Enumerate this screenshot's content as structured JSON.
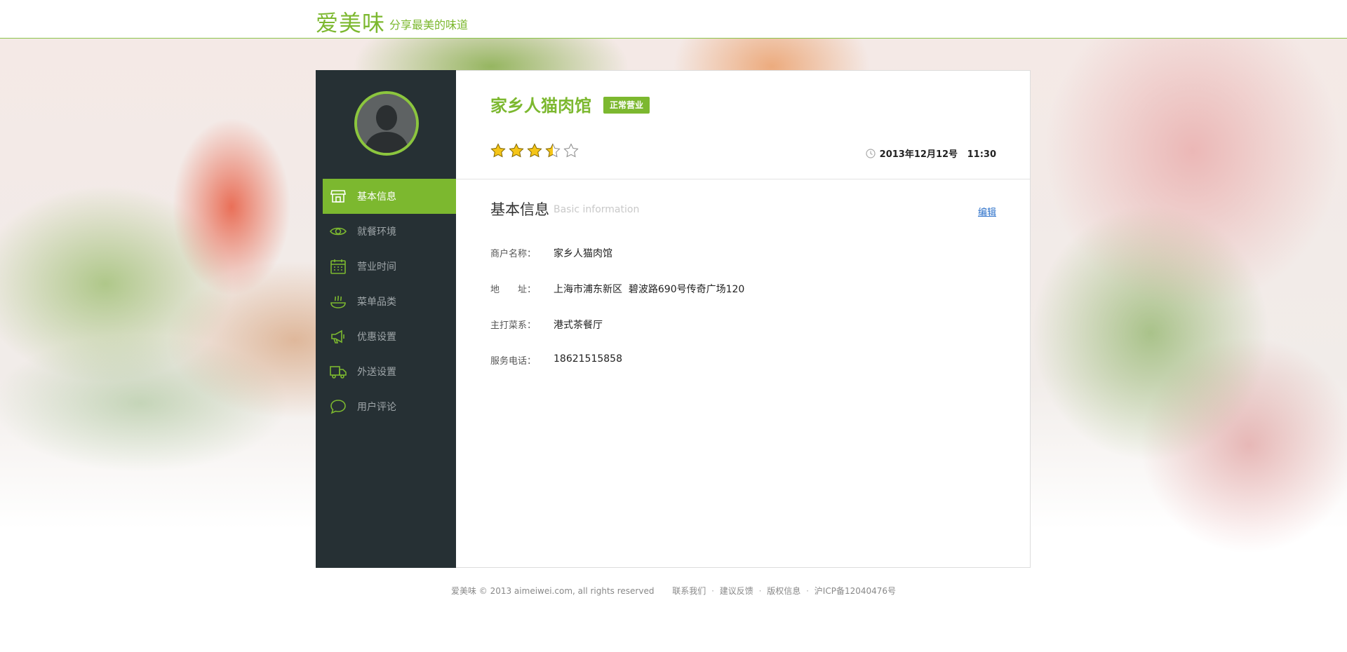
{
  "header": {
    "logo": "爱美味",
    "slogan": "分享最美的味道"
  },
  "sidebar": {
    "items": [
      {
        "label": "基本信息",
        "icon": "store-icon",
        "active": true
      },
      {
        "label": "就餐环境",
        "icon": "eye-icon",
        "active": false
      },
      {
        "label": "营业时间",
        "icon": "calendar-icon",
        "active": false
      },
      {
        "label": "菜单品类",
        "icon": "dish-icon",
        "active": false
      },
      {
        "label": "优惠设置",
        "icon": "megaphone-icon",
        "active": false
      },
      {
        "label": "外送设置",
        "icon": "truck-icon",
        "active": false
      },
      {
        "label": "用户评论",
        "icon": "chat-bubble-icon",
        "active": false
      }
    ]
  },
  "shop": {
    "name": "家乡人猫肉馆",
    "status": "正常营业",
    "rating": 3.5,
    "rating_max": 5,
    "datetime": "2013年12月12号   11:30"
  },
  "section": {
    "title": "基本信息",
    "subtitle": "Basic information",
    "edit": "编辑"
  },
  "info": {
    "name_label": "商户名称：",
    "name_value": "家乡人猫肉馆",
    "address_label": "地　　址：",
    "address_value": "上海市浦东新区  碧波路690号传奇广场120",
    "cuisine_label": "主打菜系：",
    "cuisine_value": "港式茶餐厅",
    "phone_label": "服务电话：",
    "phone_value": "18621515858"
  },
  "footer": {
    "copyright": "爱美味 © 2013 aimeiwei.com, all rights reserved",
    "links": [
      "联系我们",
      "建议反馈",
      "版权信息",
      "沪ICP备12040476号"
    ],
    "separator": "·"
  },
  "colors": {
    "accent": "#7cb82f",
    "sidebar_bg": "#263034",
    "link": "#2a6fc9",
    "star_fill": "#f5c518"
  }
}
